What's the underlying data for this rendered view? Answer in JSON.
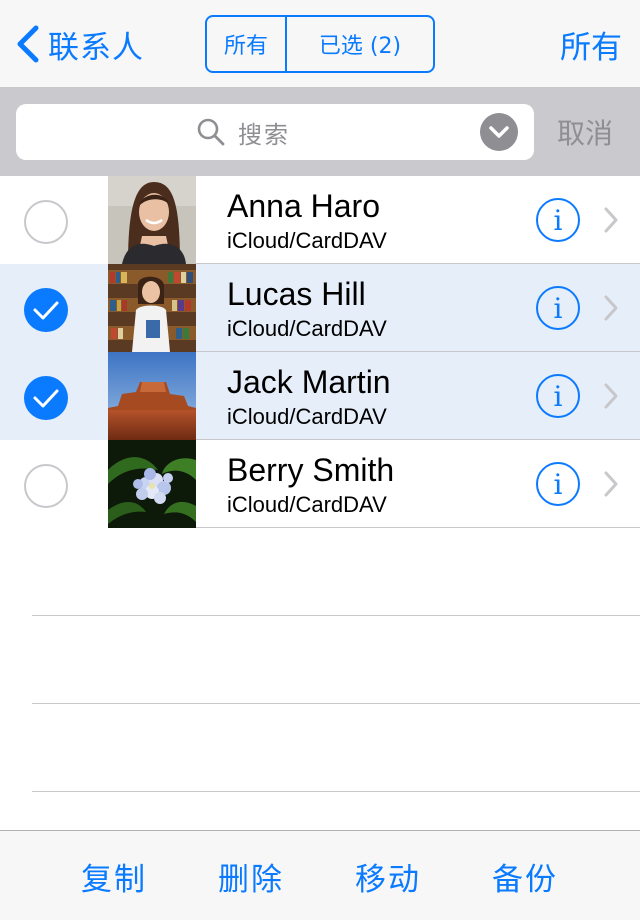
{
  "navbar": {
    "back_label": "联系人",
    "segment_all": "所有",
    "segment_selected": "已选 (2)",
    "right_label": "所有"
  },
  "search": {
    "placeholder": "搜索",
    "cancel_label": "取消"
  },
  "contacts": [
    {
      "name": "Anna Haro",
      "account": "iCloud/CardDAV",
      "selected": false,
      "photo": "woman-portrait"
    },
    {
      "name": "Lucas Hill",
      "account": "iCloud/CardDAV",
      "selected": true,
      "photo": "library-bookshelf"
    },
    {
      "name": "Jack Martin",
      "account": "iCloud/CardDAV",
      "selected": true,
      "photo": "desert-butte"
    },
    {
      "name": "Berry Smith",
      "account": "iCloud/CardDAV",
      "selected": false,
      "photo": "hydrangea-flower"
    }
  ],
  "info_glyph": "i",
  "toolbar": {
    "copy_label": "复制",
    "delete_label": "删除",
    "move_label": "移动",
    "backup_label": "备份"
  },
  "colors": {
    "accent": "#0a7aff",
    "selected_row": "#e6eef9",
    "search_bg": "#c9c9ce"
  }
}
